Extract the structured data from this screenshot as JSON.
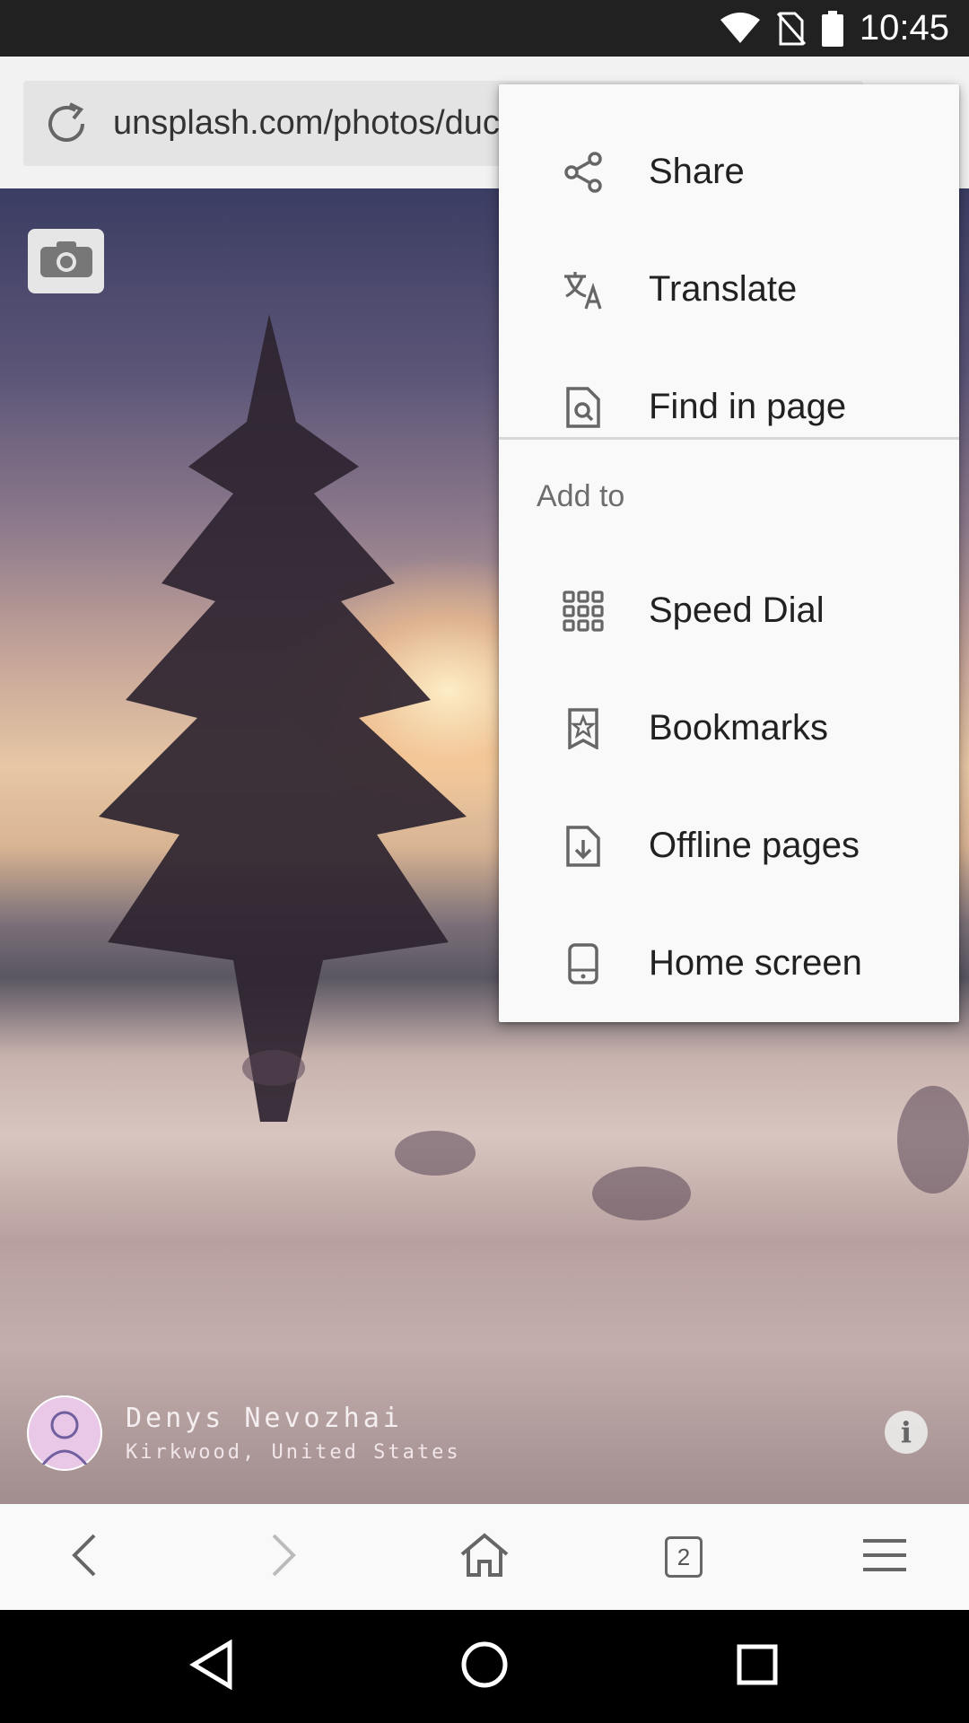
{
  "status_bar": {
    "time": "10:45",
    "icons": [
      "wifi-icon",
      "no-sim-icon",
      "battery-icon"
    ]
  },
  "address_bar": {
    "url": "unsplash.com/photos/duc",
    "reload_icon": "reload-icon"
  },
  "photo": {
    "author": "Denys Nevozhai",
    "location": "Kirkwood, United States",
    "camera_icon": "camera-icon",
    "info_icon": "info-icon",
    "info_glyph": "i"
  },
  "menu": {
    "items_top": [
      {
        "label": "Share",
        "icon": "share-icon"
      },
      {
        "label": "Translate",
        "icon": "translate-icon"
      },
      {
        "label": "Find in page",
        "icon": "find-in-page-icon"
      }
    ],
    "section_header": "Add to",
    "items_add_to": [
      {
        "label": "Speed Dial",
        "icon": "speed-dial-icon"
      },
      {
        "label": "Bookmarks",
        "icon": "bookmark-icon"
      },
      {
        "label": "Offline pages",
        "icon": "offline-pages-icon"
      },
      {
        "label": "Home screen",
        "icon": "home-screen-icon"
      }
    ]
  },
  "toolbar": {
    "tab_count": "2",
    "icons": [
      "back-icon",
      "forward-icon",
      "home-icon",
      "tabs-icon",
      "menu-icon"
    ]
  },
  "nav_bar": {
    "icons": [
      "nav-back-icon",
      "nav-home-icon",
      "nav-recents-icon"
    ]
  },
  "colors": {
    "menu_bg": "#f9f9f9",
    "status_bar": "#212121",
    "icon_gray": "#666666"
  }
}
